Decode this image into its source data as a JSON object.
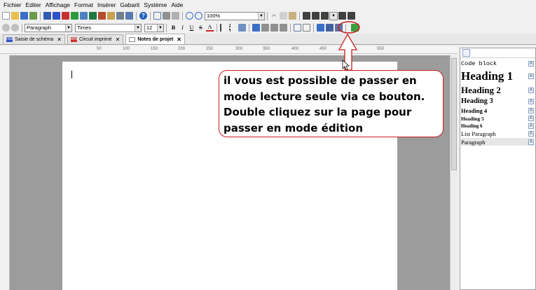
{
  "menu": [
    "Fichier",
    "Editer",
    "Affichage",
    "Format",
    "Insérer",
    "Gabarit",
    "Système",
    "Aide"
  ],
  "toolbar": {
    "zoom_value": "100%",
    "style_value": "Paragraph",
    "font_value": "Times",
    "size_value": "12",
    "bold": "B",
    "italic": "I",
    "underline": "U",
    "strike": "S",
    "font_color": "A"
  },
  "tabs": [
    {
      "label": "Saisie de schéma",
      "icon_text": "ISIS",
      "icon_color": "#3050c8",
      "active": false
    },
    {
      "label": "Circuit imprimé",
      "icon_text": "ARES",
      "icon_color": "#c83030",
      "active": false
    },
    {
      "label": "Notes de projet",
      "icon_text": "",
      "icon_color": "#ffffff",
      "active": true
    }
  ],
  "ruler": [
    "50",
    "100",
    "150",
    "200",
    "250",
    "300",
    "350",
    "400",
    "450",
    "500",
    "550"
  ],
  "styles_panel": {
    "items": [
      {
        "label": "Code block",
        "selected": false
      },
      {
        "label": "Heading 1",
        "selected": false
      },
      {
        "label": "Heading 2",
        "selected": false
      },
      {
        "label": "Heading 3",
        "selected": false
      },
      {
        "label": "Heading 4",
        "selected": false
      },
      {
        "label": "Heading 5",
        "selected": false
      },
      {
        "label": "Heading 6",
        "selected": false
      },
      {
        "label": "List Paragraph",
        "selected": false
      },
      {
        "label": "Paragraph",
        "selected": true
      }
    ],
    "icon_letter": "A"
  },
  "callout": {
    "text": "il vous est possible de passer en mode lecture seule via ce bouton. Double cliquez sur la page pour passer en mode édition",
    "border_color": "#c81e1e"
  },
  "colors": {
    "callout_red": "#c81e1e",
    "editor_gray": "#9c9c9c"
  }
}
